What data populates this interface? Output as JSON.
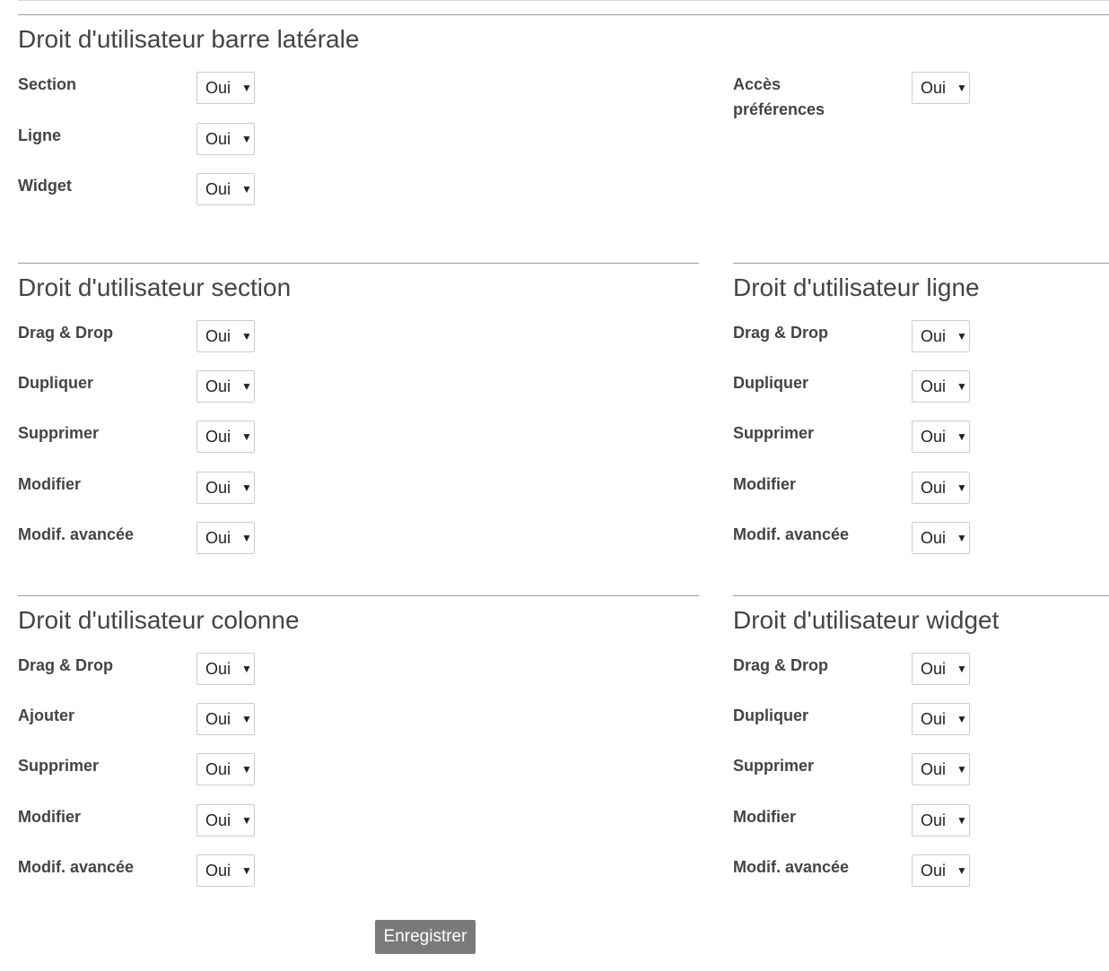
{
  "sidebar_rights": {
    "title": "Droit d'utilisateur barre latérale",
    "left_fields": [
      {
        "label": "Section",
        "value": "Oui"
      },
      {
        "label": "Ligne",
        "value": "Oui"
      },
      {
        "label": "Widget",
        "value": "Oui"
      }
    ],
    "right_fields": [
      {
        "label": "Accès préférences",
        "value": "Oui"
      }
    ]
  },
  "section_rights": {
    "title": "Droit d'utilisateur section",
    "fields": [
      {
        "label": "Drag & Drop",
        "value": "Oui"
      },
      {
        "label": "Dupliquer",
        "value": "Oui"
      },
      {
        "label": "Supprimer",
        "value": "Oui"
      },
      {
        "label": "Modifier",
        "value": "Oui"
      },
      {
        "label": "Modif. avancée",
        "value": "Oui"
      }
    ]
  },
  "row_rights": {
    "title": "Droit d'utilisateur ligne",
    "fields": [
      {
        "label": "Drag & Drop",
        "value": "Oui"
      },
      {
        "label": "Dupliquer",
        "value": "Oui"
      },
      {
        "label": "Supprimer",
        "value": "Oui"
      },
      {
        "label": "Modifier",
        "value": "Oui"
      },
      {
        "label": "Modif. avancée",
        "value": "Oui"
      }
    ]
  },
  "column_rights": {
    "title": "Droit d'utilisateur colonne",
    "fields": [
      {
        "label": "Drag & Drop",
        "value": "Oui"
      },
      {
        "label": "Ajouter",
        "value": "Oui"
      },
      {
        "label": "Supprimer",
        "value": "Oui"
      },
      {
        "label": "Modifier",
        "value": "Oui"
      },
      {
        "label": "Modif. avancée",
        "value": "Oui"
      }
    ]
  },
  "widget_rights": {
    "title": "Droit d'utilisateur widget",
    "fields": [
      {
        "label": "Drag & Drop",
        "value": "Oui"
      },
      {
        "label": "Dupliquer",
        "value": "Oui"
      },
      {
        "label": "Supprimer",
        "value": "Oui"
      },
      {
        "label": "Modifier",
        "value": "Oui"
      },
      {
        "label": "Modif. avancée",
        "value": "Oui"
      }
    ]
  },
  "select_caret_icon": "triangle-down",
  "save_label": "Enregistrer",
  "colors": {
    "button_bg": "#7a7a7a",
    "text": "#444444",
    "rule": "#9a9a9a"
  }
}
